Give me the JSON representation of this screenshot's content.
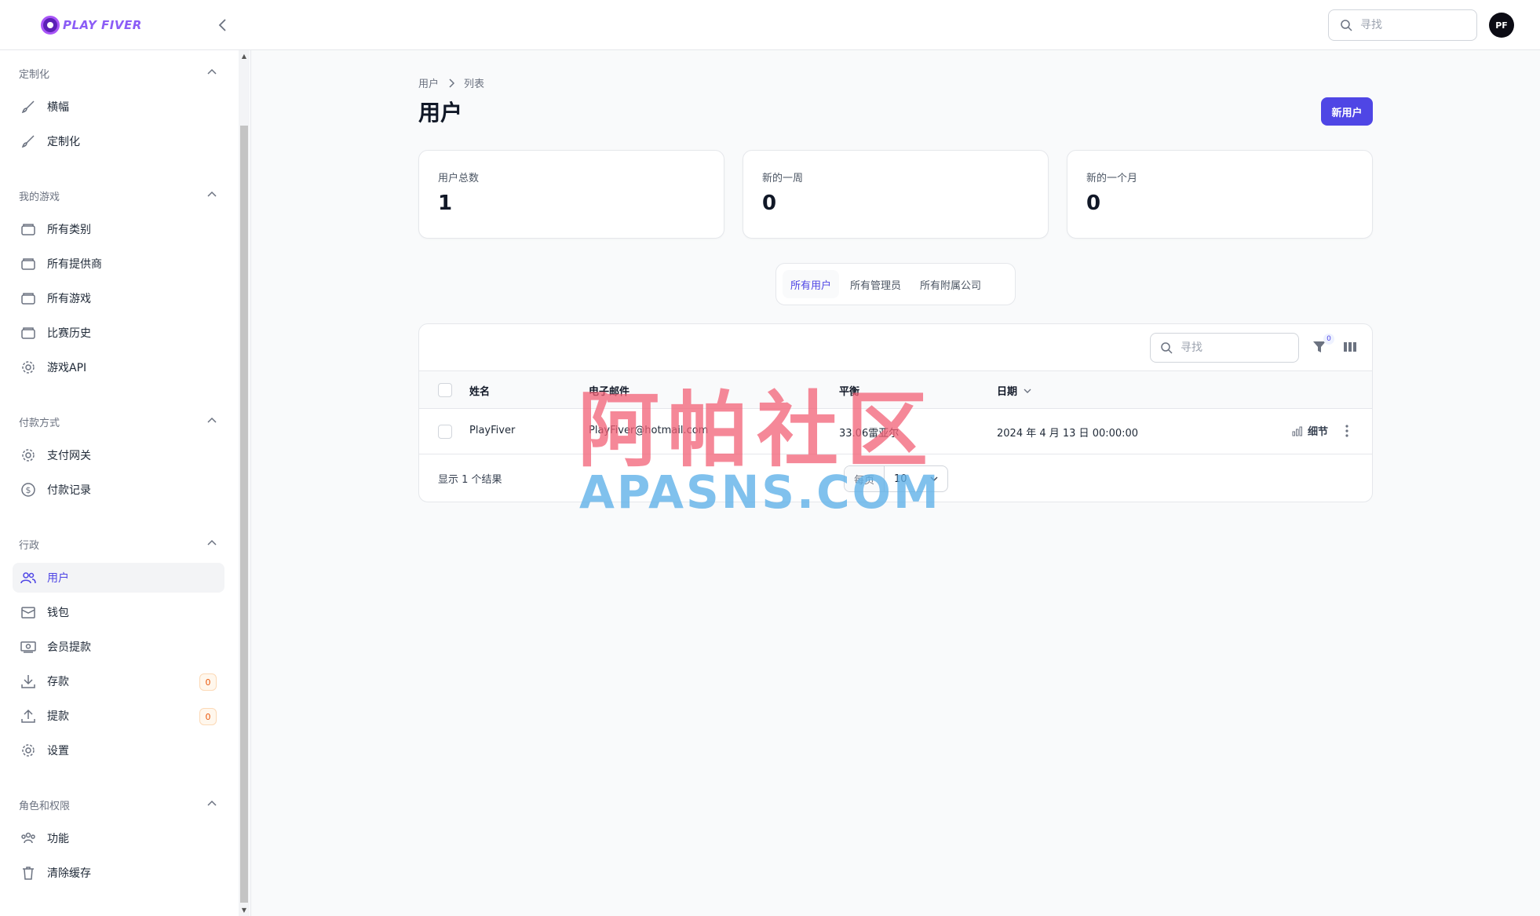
{
  "app": {
    "logo_text": "PLAY FIVER",
    "avatar_initials": "PF"
  },
  "header": {
    "search_placeholder": "寻找"
  },
  "sidebar": {
    "groups": [
      {
        "label": "定制化",
        "items": [
          {
            "label": "横幅",
            "icon": "paintbrush-icon"
          },
          {
            "label": "定制化",
            "icon": "paintbrush-icon"
          }
        ]
      },
      {
        "label": "我的游戏",
        "items": [
          {
            "label": "所有类别",
            "icon": "folder-icon"
          },
          {
            "label": "所有提供商",
            "icon": "folder-icon"
          },
          {
            "label": "所有游戏",
            "icon": "folder-icon"
          },
          {
            "label": "比赛历史",
            "icon": "folder-icon"
          },
          {
            "label": "游戏API",
            "icon": "gear-icon"
          }
        ]
      },
      {
        "label": "付款方式",
        "items": [
          {
            "label": "支付网关",
            "icon": "gear-icon"
          },
          {
            "label": "付款记录",
            "icon": "dollar-icon"
          }
        ]
      },
      {
        "label": "行政",
        "items": [
          {
            "label": "用户",
            "icon": "users-icon"
          },
          {
            "label": "钱包",
            "icon": "wallet-icon"
          },
          {
            "label": "会员提款",
            "icon": "banknote-icon"
          },
          {
            "label": "存款",
            "icon": "download-icon",
            "badge": "0"
          },
          {
            "label": "提款",
            "icon": "upload-icon",
            "badge": "0"
          },
          {
            "label": "设置",
            "icon": "gear-icon"
          }
        ]
      },
      {
        "label": "角色和权限",
        "items": [
          {
            "label": "功能",
            "icon": "user-group-icon"
          },
          {
            "label": "清除缓存",
            "icon": "trash-icon"
          }
        ]
      }
    ]
  },
  "main": {
    "breadcrumb": [
      "用户",
      "列表"
    ],
    "title": "用户",
    "new_button": "新用户",
    "stats": [
      {
        "label": "用户总数",
        "value": "1"
      },
      {
        "label": "新的一周",
        "value": "0"
      },
      {
        "label": "新的一个月",
        "value": "0"
      }
    ],
    "tabs": [
      "所有用户",
      "所有管理员",
      "所有附属公司"
    ],
    "table": {
      "search_placeholder": "寻找",
      "filter_count": "0",
      "columns": [
        "姓名",
        "电子邮件",
        "平衡",
        "日期"
      ],
      "rows": [
        {
          "name": "PlayFiver",
          "email": "PlayFiver@hotmail.com",
          "balance": "33.06雷亚尔",
          "date": "2024 年 4 月 13 日 00:00:00",
          "action": "细节"
        }
      ],
      "results_text": "显示 1 个结果",
      "per_page_label": "每页",
      "per_page_value": "10"
    }
  },
  "watermark": {
    "cn": "阿帕社区",
    "en": "APASNS.COM"
  },
  "colors": {
    "accent": "#4f46e5",
    "badge": "#ea580c"
  }
}
